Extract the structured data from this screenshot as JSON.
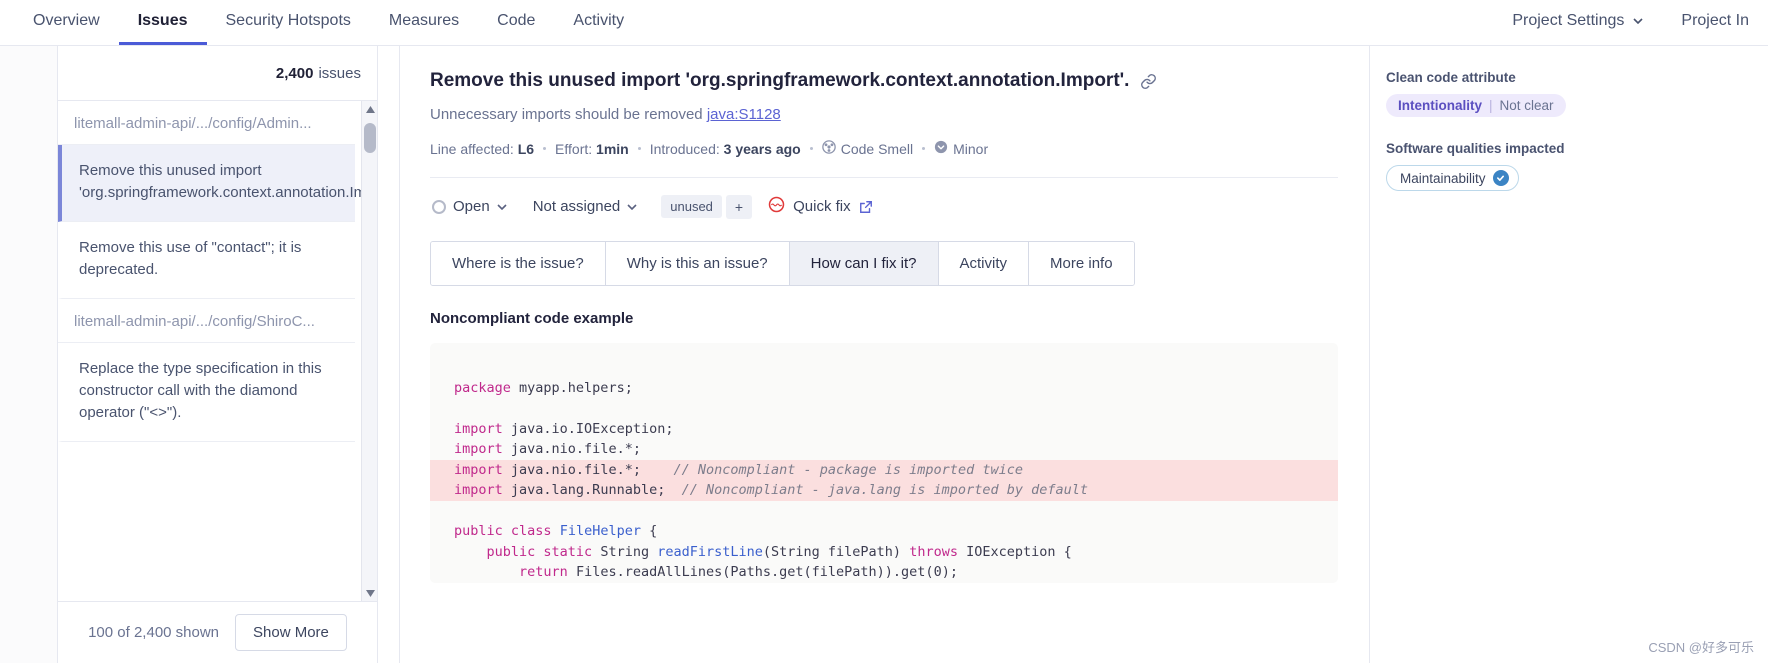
{
  "topnav": {
    "left_items": [
      {
        "label": "Overview",
        "active": false
      },
      {
        "label": "Issues",
        "active": true
      },
      {
        "label": "Security Hotspots",
        "active": false
      },
      {
        "label": "Measures",
        "active": false
      },
      {
        "label": "Code",
        "active": false
      },
      {
        "label": "Activity",
        "active": false
      }
    ],
    "right_items": [
      {
        "label": "Project Settings",
        "has_chevron": true
      },
      {
        "label": "Project In",
        "has_chevron": false
      }
    ]
  },
  "sidebar": {
    "count": "2,400",
    "count_label": "issues",
    "rows": [
      {
        "type": "file",
        "label": "litemall-admin-api/.../config/Admin..."
      },
      {
        "type": "issue",
        "label": "Remove this unused import 'org.springframework.context.annotation.Import'.",
        "selected": true
      },
      {
        "type": "issue",
        "label": "Remove this use of \"contact\"; it is deprecated.",
        "selected": false
      },
      {
        "type": "file",
        "label": "litemall-admin-api/.../config/ShiroC..."
      },
      {
        "type": "issue",
        "label": "Replace the type specification in this constructor call with the diamond operator (\"<>\").",
        "selected": false
      }
    ],
    "footer": {
      "shown_text": "100 of 2,400 shown",
      "show_more_label": "Show More"
    }
  },
  "issue": {
    "title": "Remove this unused import 'org.springframework.context.annotation.Import'.",
    "subtitle": "Unnecessary imports should be removed",
    "rule_key": "java:S1128",
    "meta": {
      "line_label": "Line affected:",
      "line_value": "L6",
      "effort_label": "Effort:",
      "effort_value": "1min",
      "introduced_label": "Introduced:",
      "introduced_value": "3 years ago",
      "type_label": "Code Smell",
      "severity_label": "Minor"
    },
    "status": {
      "state": "Open",
      "assignee": "Not assigned",
      "tag": "unused",
      "add_tag": "+",
      "quick_fix": "Quick fix"
    },
    "tabs": [
      {
        "label": "Where is the issue?",
        "active": false
      },
      {
        "label": "Why is this an issue?",
        "active": false
      },
      {
        "label": "How can I fix it?",
        "active": true
      },
      {
        "label": "Activity",
        "active": false
      },
      {
        "label": "More info",
        "active": false
      }
    ],
    "section_title": "Noncompliant code example",
    "code_lines": [
      {
        "highlight": false,
        "tokens": [
          {
            "t": "",
            "c": ""
          }
        ]
      },
      {
        "highlight": false,
        "tokens": [
          {
            "t": "package",
            "c": "kw"
          },
          {
            "t": " myapp.helpers;",
            "c": ""
          }
        ]
      },
      {
        "highlight": false,
        "tokens": [
          {
            "t": "",
            "c": ""
          }
        ]
      },
      {
        "highlight": false,
        "tokens": [
          {
            "t": "import",
            "c": "kw"
          },
          {
            "t": " java.io.IOException;",
            "c": ""
          }
        ]
      },
      {
        "highlight": false,
        "tokens": [
          {
            "t": "import",
            "c": "kw"
          },
          {
            "t": " java.nio.file.*;",
            "c": ""
          }
        ]
      },
      {
        "highlight": true,
        "tokens": [
          {
            "t": "import",
            "c": "kw"
          },
          {
            "t": " java.nio.file.*;    ",
            "c": ""
          },
          {
            "t": "// Noncompliant - package is imported twice",
            "c": "cm"
          }
        ]
      },
      {
        "highlight": true,
        "tokens": [
          {
            "t": "import",
            "c": "kw"
          },
          {
            "t": " java.lang.Runnable;  ",
            "c": ""
          },
          {
            "t": "// Noncompliant - java.lang is imported by default",
            "c": "cm"
          }
        ]
      },
      {
        "highlight": false,
        "tokens": [
          {
            "t": "",
            "c": ""
          }
        ]
      },
      {
        "highlight": false,
        "tokens": [
          {
            "t": "public class",
            "c": "kw"
          },
          {
            "t": " ",
            "c": ""
          },
          {
            "t": "FileHelper",
            "c": "ty"
          },
          {
            "t": " {",
            "c": ""
          }
        ]
      },
      {
        "highlight": false,
        "tokens": [
          {
            "t": "    ",
            "c": ""
          },
          {
            "t": "public static",
            "c": "kw"
          },
          {
            "t": " String ",
            "c": ""
          },
          {
            "t": "readFirstLine",
            "c": "fn"
          },
          {
            "t": "(String filePath) ",
            "c": ""
          },
          {
            "t": "throws",
            "c": "kw"
          },
          {
            "t": " IOException {",
            "c": ""
          }
        ]
      },
      {
        "highlight": false,
        "tokens": [
          {
            "t": "        ",
            "c": ""
          },
          {
            "t": "return",
            "c": "kw"
          },
          {
            "t": " Files.readAllLines(Paths.get(filePath)).get(",
            "c": ""
          },
          {
            "t": "0",
            "c": ""
          },
          {
            "t": ");",
            "c": ""
          }
        ]
      }
    ]
  },
  "rail": {
    "clean_code_label": "Clean code attribute",
    "clean_code_value": "Intentionality",
    "clean_code_sub": "Not clear",
    "qualities_label": "Software qualities impacted",
    "quality_value": "Maintainability"
  },
  "watermark": "CSDN @好多可乐",
  "colors": {
    "accent": "#4b5bd7",
    "selected_bg": "#eef0f9",
    "highlight_row": "#fbdfdf",
    "keyword": "#c0298c",
    "comment": "#7d7d8c",
    "link": "#5b63d3",
    "quickfix_red": "#e03a3a"
  }
}
